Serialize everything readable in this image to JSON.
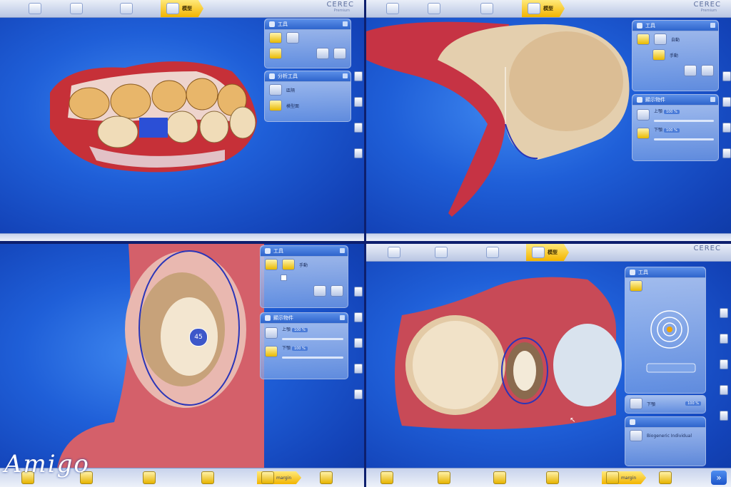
{
  "brand": {
    "name": "CEREC",
    "sub": "Premium"
  },
  "top_steps": {
    "s1": "",
    "s2": "",
    "s3": "",
    "s4": "模型"
  },
  "q1": {
    "panel_tools": {
      "title": "工具",
      "tool1": "",
      "tool2": ""
    },
    "panel_analysis": {
      "title": "分析工具",
      "item1": "區隔",
      "item2": "模型面"
    }
  },
  "q2": {
    "panel_tools": {
      "title": "工具",
      "item1": "自動",
      "item2": "手動"
    },
    "panel_display": {
      "title": "顯示物件",
      "upper": "上顎",
      "upper_pct": "100 %",
      "lower": "下顎",
      "lower_pct": "100 %"
    }
  },
  "q3": {
    "panel_tools": {
      "title": "工具",
      "item1": "手動",
      "item2": ""
    },
    "panel_display": {
      "title": "顯示物件",
      "upper": "上顎",
      "upper_pct": "100 %",
      "lower": "下顎",
      "lower_pct": "100 %"
    },
    "tooth_number": "45",
    "bottom_steps": {
      "s1": "",
      "s2": "",
      "s3": "",
      "s4": "",
      "s5": "margin",
      "s6": ""
    }
  },
  "q4": {
    "panel_tools": {
      "title": "工具",
      "item1": ""
    },
    "panel_lower": {
      "lower": "下顎",
      "lower_pct": "100 %"
    },
    "panel_info": {
      "title": "",
      "line1": "",
      "line2": "Biogeneric Individual",
      "line3": "",
      "line4": ""
    },
    "bottom_steps": {
      "s1": "",
      "s2": "",
      "s3": "",
      "s4": "",
      "s5": "margin",
      "s6": ""
    }
  },
  "watermark": "Amigo"
}
